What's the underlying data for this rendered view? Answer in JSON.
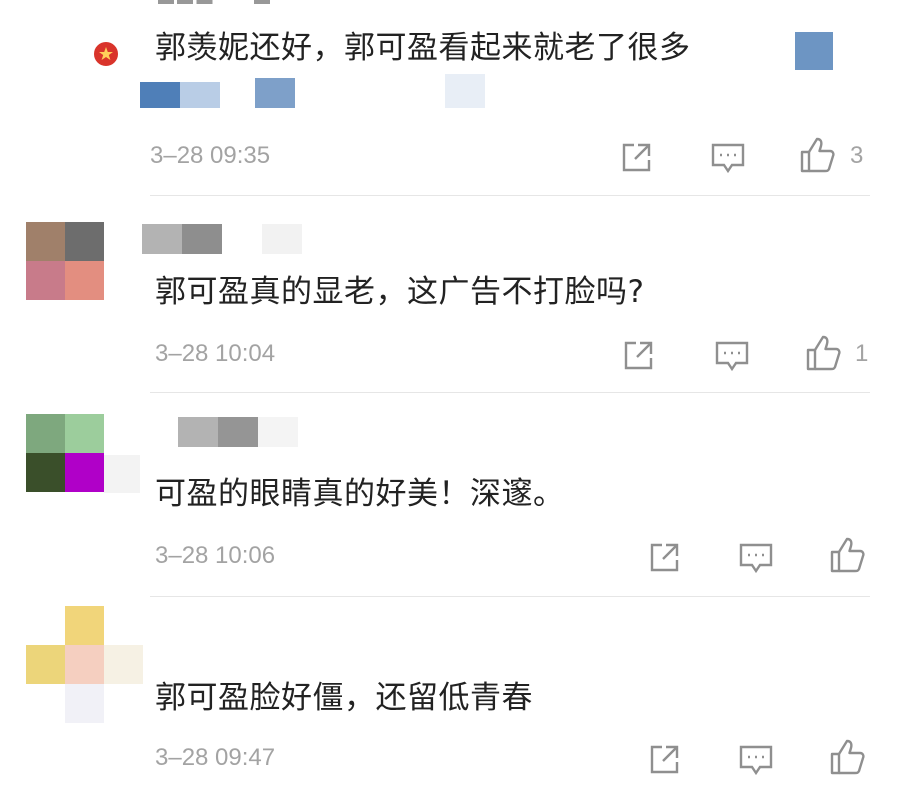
{
  "comments": [
    {
      "text": "郭羡妮还好，郭可盈看起来就老了很多",
      "time": "3–28 09:35",
      "likes": "3",
      "verified_badge": "verified-badge-icon"
    },
    {
      "text": "郭可盈真的显老，这广告不打脸吗?",
      "time": "3–28 10:04",
      "likes": "1"
    },
    {
      "text": "可盈的眼睛真的好美！深邃。",
      "time": "3–28 10:06",
      "likes": ""
    },
    {
      "text": "郭可盈脸好僵，还留低青春",
      "time": "3–28 09:47",
      "likes": ""
    }
  ],
  "icons": {
    "share": "share-icon",
    "reply": "comment-icon",
    "like": "thumbs-up-icon"
  },
  "colors": {
    "text": "#222222",
    "meta": "#a3a3a3",
    "divider": "#e6e6e6",
    "mosaic_blue": "#6d95c3"
  }
}
